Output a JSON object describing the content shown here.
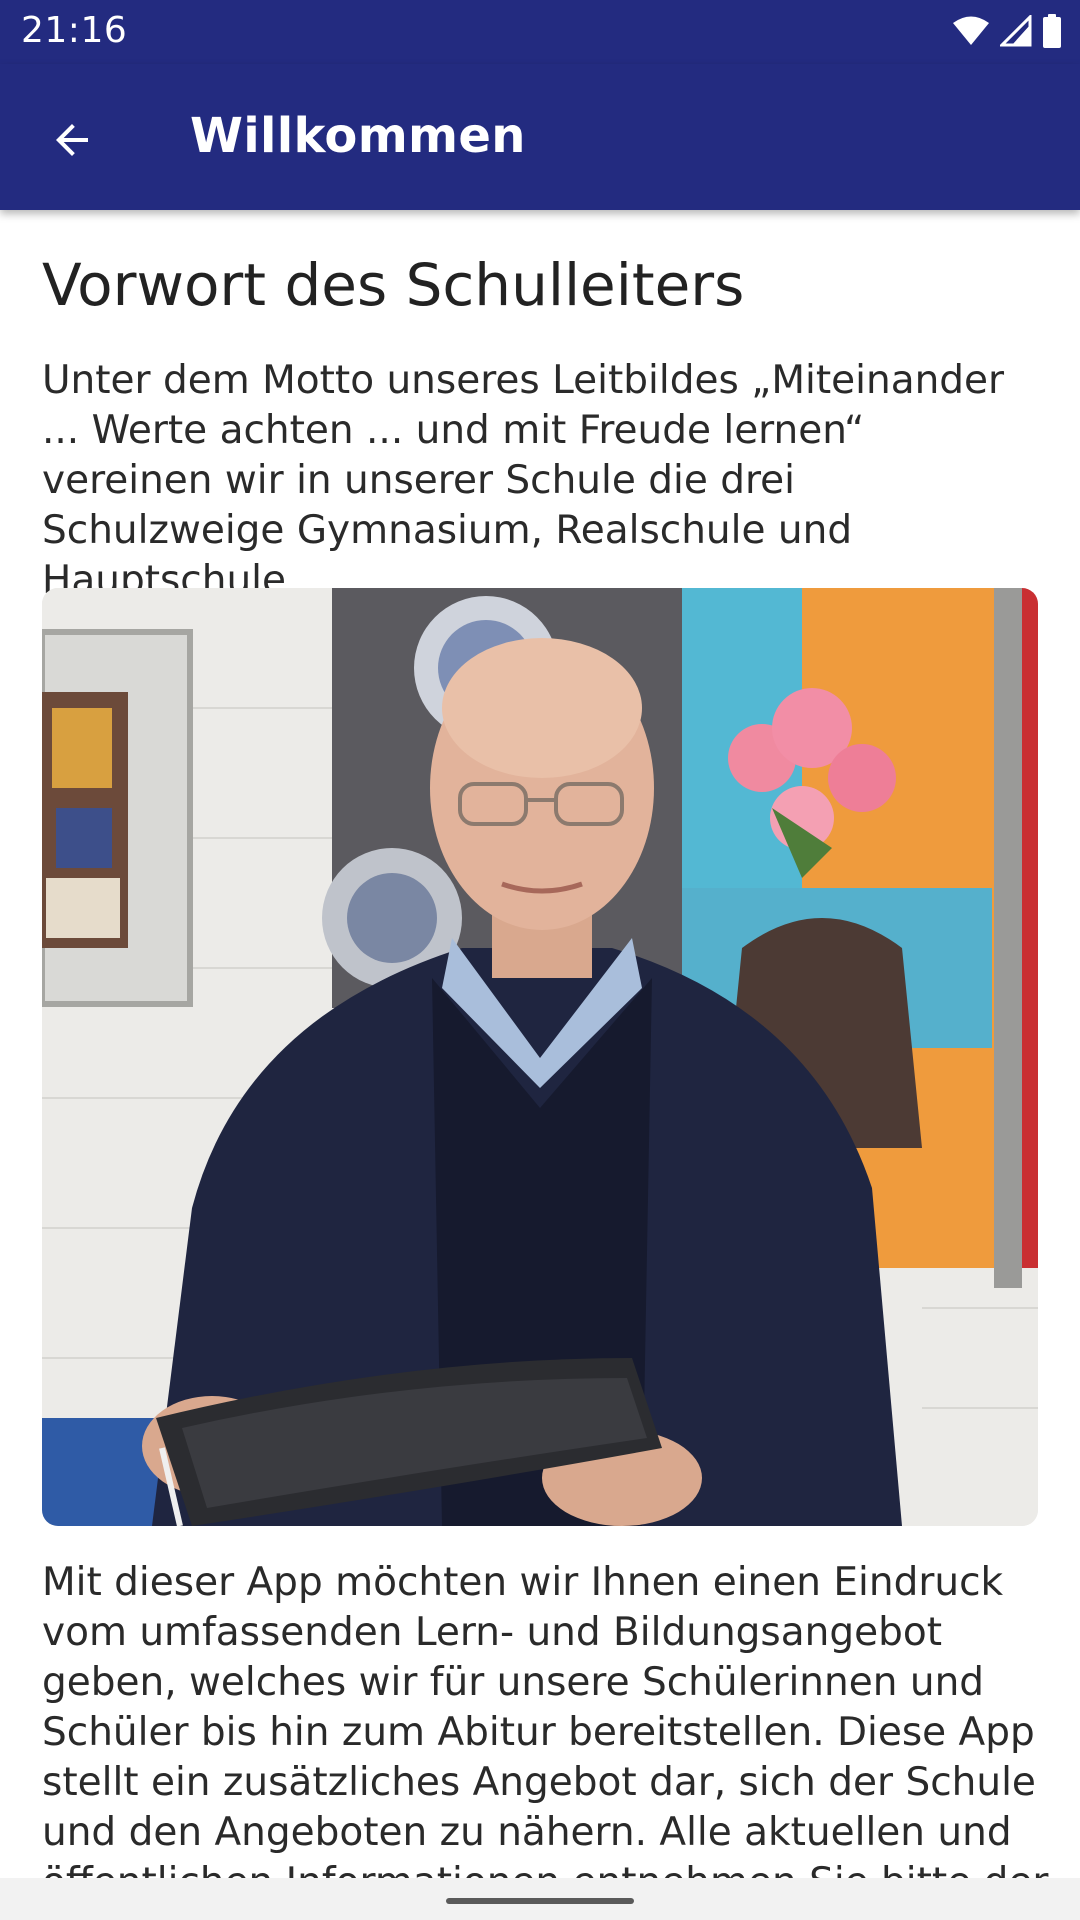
{
  "status_bar": {
    "time": "21:16",
    "icons": [
      "wifi-icon",
      "cell-signal-icon",
      "battery-icon"
    ]
  },
  "app_bar": {
    "back_icon": "arrow-back-icon",
    "title": "Willkommen",
    "color": "#232b80"
  },
  "content": {
    "heading": "Vorwort des Schulleiters",
    "intro": "Unter dem Motto unseres Leitbildes „Miteinander ... Werte achten ... und mit Freude lernen“ vereinen wir in unserer Schule die drei Schulzweige Gymnasium, Realschule und Hauptschule.",
    "photo": "portrait-photo",
    "body": "Mit dieser App möchten wir Ihnen einen Eindruck vom umfassenden Lern- und Bildungsangebot geben, welches wir für unsere Schülerinnen und Schüler bis hin zum Abitur bereitstellen. Diese App stellt ein zusätzliches Angebot dar, sich der Schule und den Angeboten zu nähern. Alle aktuellen und öffentlichen Informationen entnehmen Sie bitte der"
  }
}
